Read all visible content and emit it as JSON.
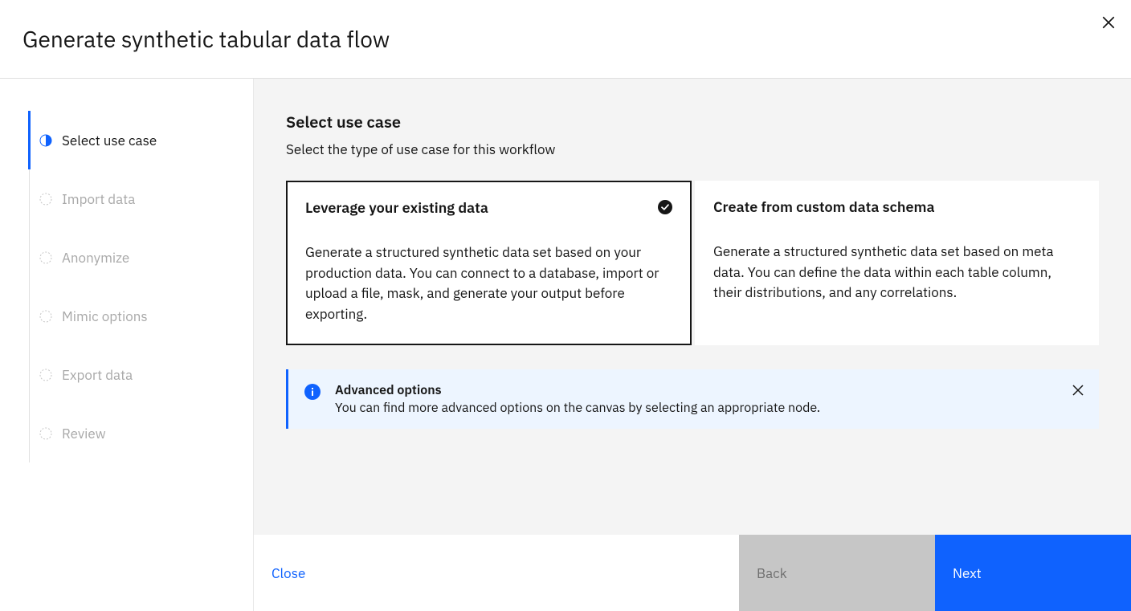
{
  "header": {
    "title": "Generate synthetic tabular data flow"
  },
  "steps": [
    {
      "label": "Select use case",
      "active": true
    },
    {
      "label": "Import data",
      "active": false
    },
    {
      "label": "Anonymize",
      "active": false
    },
    {
      "label": "Mimic options",
      "active": false
    },
    {
      "label": "Export data",
      "active": false
    },
    {
      "label": "Review",
      "active": false
    }
  ],
  "section": {
    "title": "Select use case",
    "subtitle": "Select the type of use case for this workflow"
  },
  "cards": [
    {
      "title": "Leverage your existing data",
      "desc": "Generate a structured synthetic data set based on your production data. You can connect to a database, import or upload a file, mask, and generate your output before exporting.",
      "selected": true
    },
    {
      "title": "Create from custom data schema",
      "desc": "Generate a structured synthetic data set based on meta data. You can define the data within each table column, their distributions, and any correlations.",
      "selected": false
    }
  ],
  "info": {
    "title": "Advanced options",
    "body": "You can find more advanced options on the canvas by selecting an appropriate node."
  },
  "footer": {
    "close": "Close",
    "back": "Back",
    "next": "Next"
  }
}
